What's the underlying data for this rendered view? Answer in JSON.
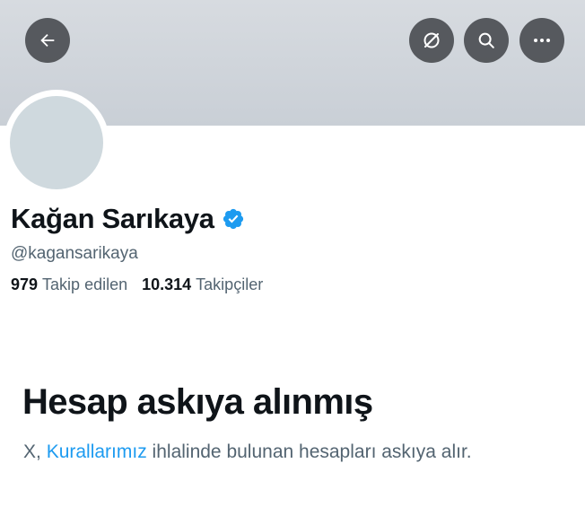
{
  "header": {
    "back_icon": "arrow-left-icon",
    "grok_icon": "grok-slash-circle-icon",
    "search_icon": "search-icon",
    "more_icon": "more-horizontal-icon"
  },
  "profile": {
    "display_name": "Kağan Sarıkaya",
    "verified_icon": "verified-badge-icon",
    "verified_color": "#1d9bf0",
    "handle": "@kagansarikaya",
    "following_count": "979",
    "following_label": "Takip edilen",
    "followers_count": "10.314",
    "followers_label": "Takipçiler"
  },
  "suspension": {
    "title": "Hesap askıya alınmış",
    "text_prefix": "X, ",
    "rules_link": "Kurallarımız",
    "text_suffix": " ihlalinde bulunan hesapları askıya alır."
  },
  "colors": {
    "banner": "#cfd5db",
    "accent": "#1d9bf0",
    "secondary_text": "#536471",
    "primary_text": "#0f1419"
  }
}
